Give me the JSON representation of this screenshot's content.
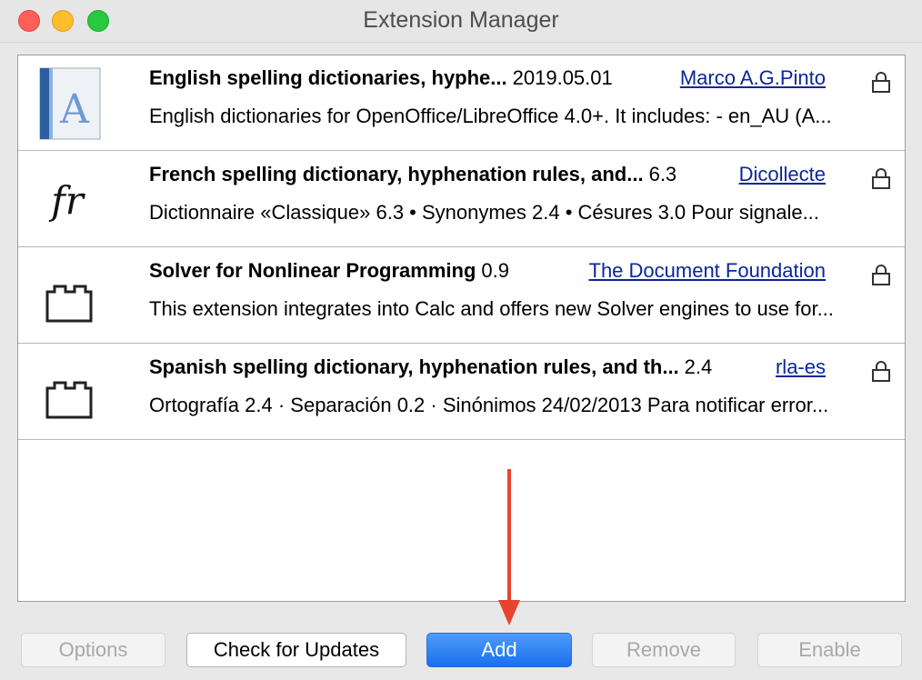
{
  "window": {
    "title": "Extension Manager"
  },
  "extensions": [
    {
      "name": "English spelling dictionaries, hyphe...",
      "version": "2019.05.01",
      "author": "Marco A.G.Pinto",
      "description": "English dictionaries for OpenOffice/LibreOffice 4.0+.  It includes: - en_AU (A...",
      "icon": "dictionary-book-icon"
    },
    {
      "name": "French spelling dictionary, hyphenation rules, and...",
      "version": "6.3",
      "author": "Dicollecte",
      "description": "Dictionnaire «Classique» 6.3 • Synonymes 2.4 • Césures 3.0   Pour signale...",
      "icon": "fr-text-icon",
      "icon_text": "fr"
    },
    {
      "name": "Solver for Nonlinear Programming",
      "version": "0.9",
      "author": "The Document Foundation",
      "description": "This extension integrates into Calc and offers new Solver engines to use for...",
      "icon": "puzzle-block-icon"
    },
    {
      "name": "Spanish spelling dictionary, hyphenation rules, and th...",
      "version": "2.4",
      "author": "rla-es",
      "description": "Ortografía 2.4 · Separación 0.2 · Sinónimos 24/02/2013  Para notificar error...",
      "icon": "puzzle-block-icon"
    }
  ],
  "buttons": {
    "options": "Options",
    "check_updates": "Check for Updates",
    "add": "Add",
    "remove": "Remove",
    "enable": "Enable"
  },
  "colors": {
    "link": "#0b2699",
    "primary_button": "#1a6ff0",
    "annotation_arrow": "#e8432e"
  }
}
